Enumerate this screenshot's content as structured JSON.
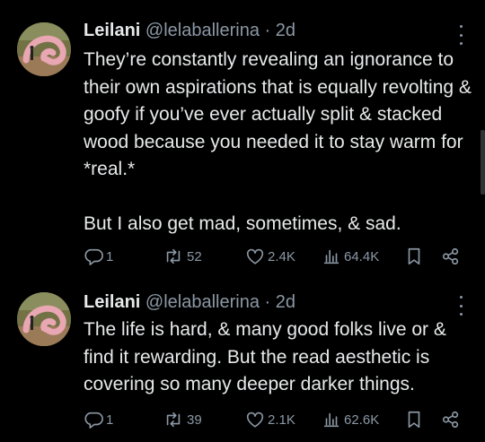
{
  "tweets": [
    {
      "author_name": "Leilani",
      "handle": "@lelaballerina",
      "separator": "·",
      "time": "2d",
      "paragraphs": [
        "They’re constantly revealing an ignorance to their own aspirations that is equally revolting & goofy if you’ve ever actually split & stacked wood because you needed it to stay warm for *real.*",
        "But I also get mad, sometimes, & sad."
      ],
      "stats": {
        "replies": "1",
        "reposts": "52",
        "likes": "2.4K",
        "views": "64.4K"
      }
    },
    {
      "author_name": "Leilani",
      "handle": "@lelaballerina",
      "separator": "·",
      "time": "2d",
      "paragraphs": [
        "The life is hard, & many good folks live or & find it rewarding. But the read aesthetic is covering so many deeper darker things."
      ],
      "stats": {
        "replies": "1",
        "reposts": "39",
        "likes": "2.1K",
        "views": "62.6K"
      }
    }
  ],
  "icons": {
    "reply": "reply-icon",
    "repost": "repost-icon",
    "like": "heart-icon",
    "views": "views-chart-icon",
    "bookmark": "bookmark-icon",
    "share": "share-icon",
    "more": "more-vertical-icon"
  },
  "colors": {
    "background": "#000000",
    "primary_text": "#e7e9ea",
    "secondary_text": "#8b98a5"
  }
}
